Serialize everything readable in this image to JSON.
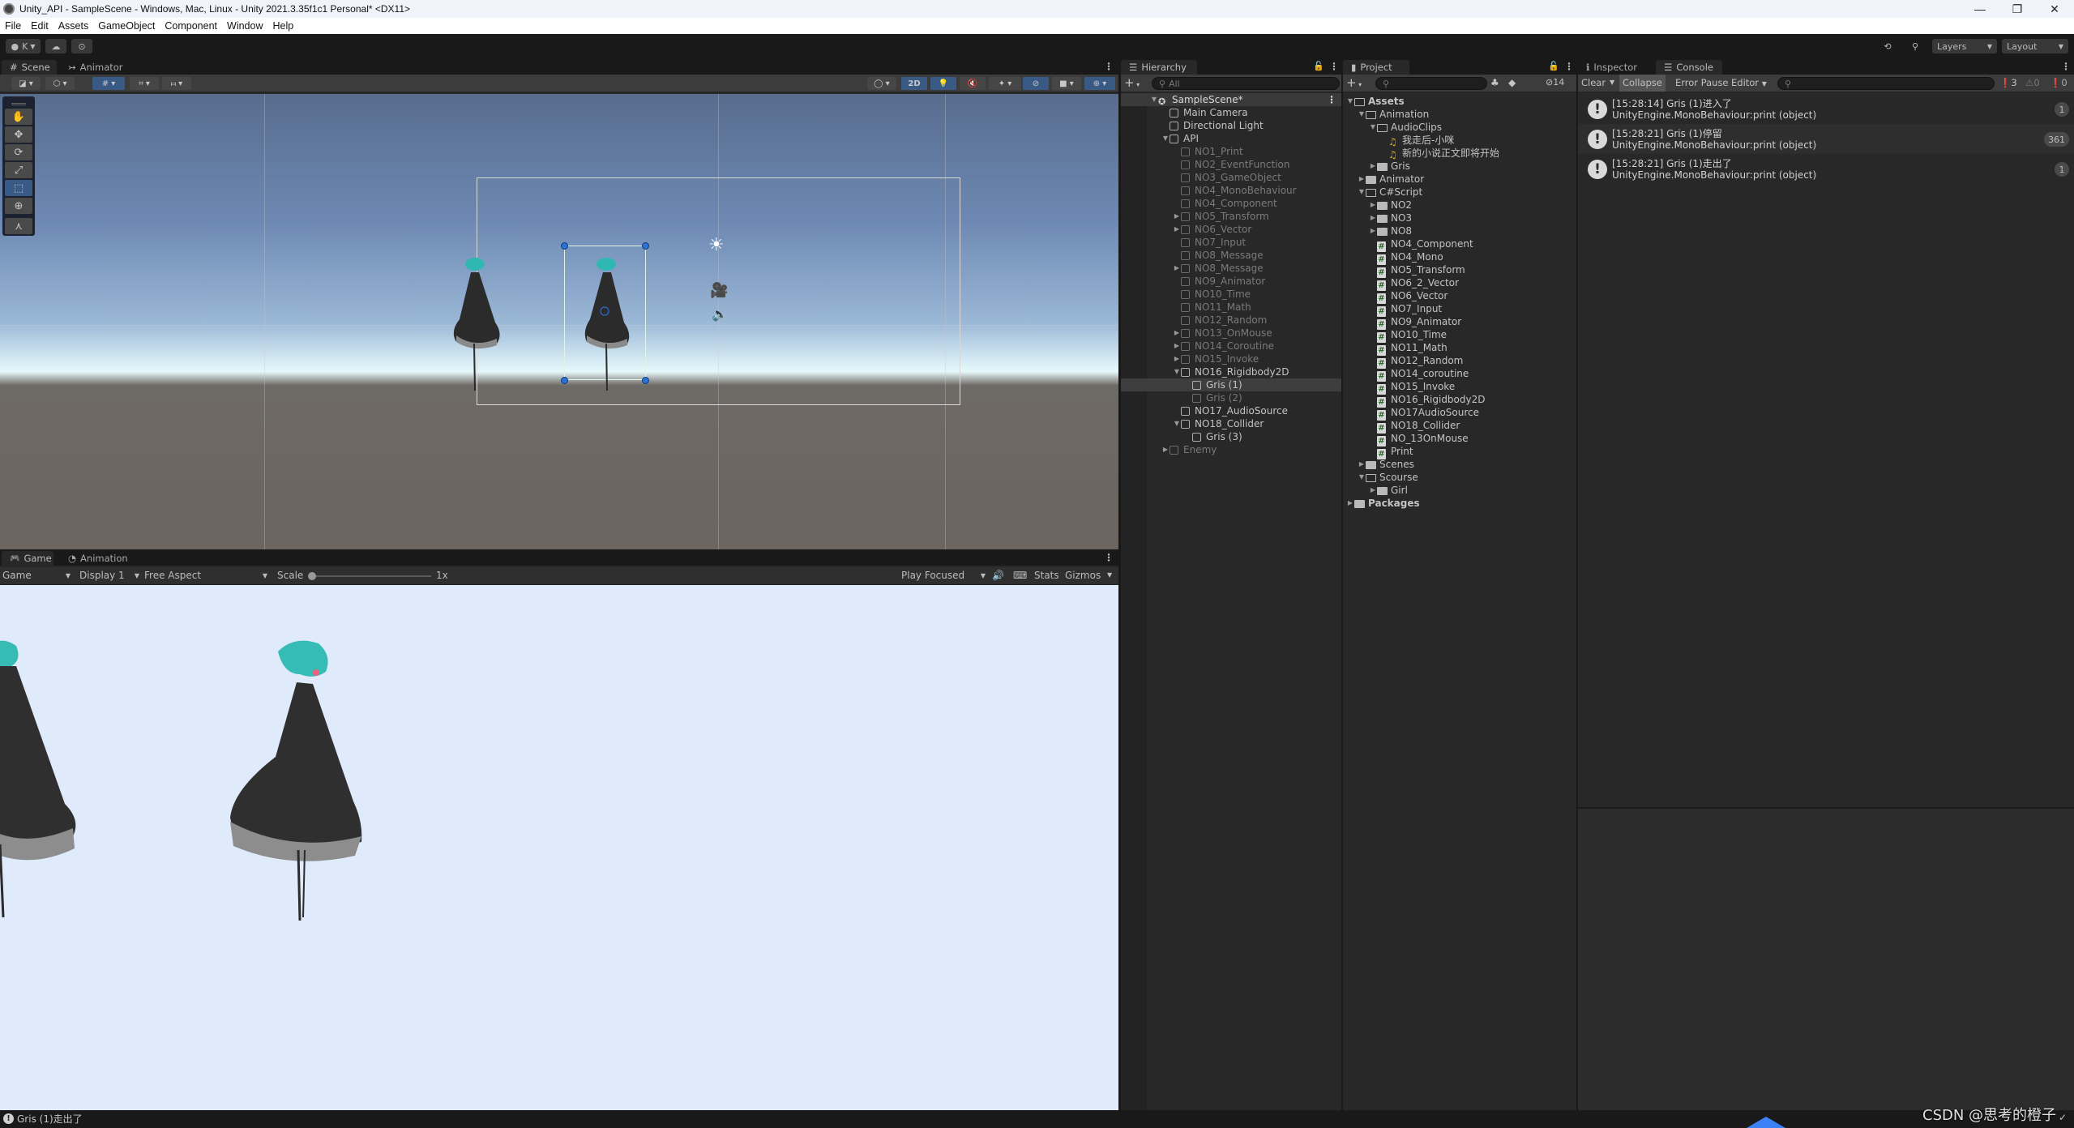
{
  "window": {
    "title": "Unity_API - SampleScene - Windows, Mac, Linux - Unity 2021.3.35f1c1 Personal* <DX11>",
    "controls": {
      "minimize": "—",
      "maximize": "❐",
      "close": "✕"
    }
  },
  "menu": [
    "File",
    "Edit",
    "Assets",
    "GameObject",
    "Component",
    "Window",
    "Help"
  ],
  "main_toolbar": {
    "account_label": "K",
    "play_icon": "▶",
    "pause_icon": "❚❚",
    "step_icon": "▶|",
    "layers_label": "Layers",
    "layout_label": "Layout"
  },
  "scene_panel": {
    "tabs": [
      {
        "label": "Scene",
        "icon": "#"
      },
      {
        "label": "Animator",
        "icon": "↣"
      }
    ],
    "toolbar": {
      "mode_2d": "2D"
    },
    "tools": [
      "hand-tool",
      "move-tool",
      "rotate-tool",
      "scale-tool",
      "rect-tool",
      "transform-tool",
      "custom-tool"
    ]
  },
  "game_panel": {
    "tabs": [
      {
        "label": "Game",
        "icon": "🎮"
      },
      {
        "label": "Animation",
        "icon": "◔"
      }
    ],
    "toolbar": {
      "view_select": "Game",
      "display_select": "Display 1",
      "aspect_select": "Free Aspect",
      "scale_label": "Scale",
      "scale_value": "1x",
      "scale_fraction": 0.0,
      "play_mode_select": "Play Focused",
      "stats_label": "Stats",
      "gizmos_label": "Gizmos"
    }
  },
  "hierarchy": {
    "tab_label": "Hierarchy",
    "search_placeholder": "All",
    "items": [
      {
        "label": "SampleScene*",
        "depth": 0,
        "arrow": "▼",
        "icon": "unity",
        "style": "scene"
      },
      {
        "label": "Main Camera",
        "depth": 1,
        "arrow": "",
        "icon": "cube",
        "style": "normal"
      },
      {
        "label": "Directional Light",
        "depth": 1,
        "arrow": "",
        "icon": "cube",
        "style": "normal"
      },
      {
        "label": "API",
        "depth": 1,
        "arrow": "▼",
        "icon": "cube",
        "style": "normal"
      },
      {
        "label": "NO1_Print",
        "depth": 2,
        "arrow": "",
        "icon": "cube",
        "style": "dim"
      },
      {
        "label": "NO2_EventFunction",
        "depth": 2,
        "arrow": "",
        "icon": "cube",
        "style": "dim"
      },
      {
        "label": "NO3_GameObject",
        "depth": 2,
        "arrow": "",
        "icon": "cube",
        "style": "dim"
      },
      {
        "label": "NO4_MonoBehaviour",
        "depth": 2,
        "arrow": "",
        "icon": "cube",
        "style": "dim"
      },
      {
        "label": "NO4_Component",
        "depth": 2,
        "arrow": "",
        "icon": "cube",
        "style": "dim"
      },
      {
        "label": "NO5_Transform",
        "depth": 2,
        "arrow": "▶",
        "icon": "cube",
        "style": "dim"
      },
      {
        "label": "NO6_Vector",
        "depth": 2,
        "arrow": "▶",
        "icon": "cube",
        "style": "dim"
      },
      {
        "label": "NO7_Input",
        "depth": 2,
        "arrow": "",
        "icon": "cube",
        "style": "dim"
      },
      {
        "label": "NO8_Message",
        "depth": 2,
        "arrow": "",
        "icon": "cube",
        "style": "dim"
      },
      {
        "label": "NO8_Message",
        "depth": 2,
        "arrow": "▶",
        "icon": "cube",
        "style": "dim"
      },
      {
        "label": "NO9_Animator",
        "depth": 2,
        "arrow": "",
        "icon": "cube",
        "style": "dim"
      },
      {
        "label": "NO10_Time",
        "depth": 2,
        "arrow": "",
        "icon": "cube",
        "style": "dim"
      },
      {
        "label": "NO11_Math",
        "depth": 2,
        "arrow": "",
        "icon": "cube",
        "style": "dim"
      },
      {
        "label": "NO12_Random",
        "depth": 2,
        "arrow": "",
        "icon": "cube",
        "style": "dim"
      },
      {
        "label": "NO13_OnMouse",
        "depth": 2,
        "arrow": "▶",
        "icon": "cube",
        "style": "dim"
      },
      {
        "label": "NO14_Coroutine",
        "depth": 2,
        "arrow": "▶",
        "icon": "cube",
        "style": "dim"
      },
      {
        "label": "NO15_Invoke",
        "depth": 2,
        "arrow": "▶",
        "icon": "cube",
        "style": "dim"
      },
      {
        "label": "NO16_Rigidbody2D",
        "depth": 2,
        "arrow": "▼",
        "icon": "cube",
        "style": "normal"
      },
      {
        "label": "Gris (1)",
        "depth": 3,
        "arrow": "",
        "icon": "cube",
        "style": "selected"
      },
      {
        "label": "Gris (2)",
        "depth": 3,
        "arrow": "",
        "icon": "cube",
        "style": "dim"
      },
      {
        "label": "NO17_AudioSource",
        "depth": 2,
        "arrow": "",
        "icon": "cube",
        "style": "normal"
      },
      {
        "label": "NO18_Collider",
        "depth": 2,
        "arrow": "▼",
        "icon": "cube",
        "style": "normal"
      },
      {
        "label": "Gris (3)",
        "depth": 3,
        "arrow": "",
        "icon": "cube",
        "style": "normal"
      },
      {
        "label": "Enemy",
        "depth": 1,
        "arrow": "▶",
        "icon": "cube",
        "style": "dim"
      }
    ]
  },
  "project": {
    "tab_label": "Project",
    "hidden_count": "14",
    "items": [
      {
        "label": "Assets",
        "depth": 0,
        "arrow": "▼",
        "icon": "folder-open",
        "bold": true
      },
      {
        "label": "Animation",
        "depth": 1,
        "arrow": "▼",
        "icon": "folder-open"
      },
      {
        "label": "AudioClips",
        "depth": 2,
        "arrow": "▼",
        "icon": "folder-open"
      },
      {
        "label": "我走后-小咪",
        "depth": 3,
        "arrow": "",
        "icon": "audio"
      },
      {
        "label": "新的小说正文即将开始",
        "depth": 3,
        "arrow": "",
        "icon": "audio"
      },
      {
        "label": "Gris",
        "depth": 2,
        "arrow": "▶",
        "icon": "folder"
      },
      {
        "label": "Animator",
        "depth": 1,
        "arrow": "▶",
        "icon": "folder"
      },
      {
        "label": "C#Script",
        "depth": 1,
        "arrow": "▼",
        "icon": "folder-open"
      },
      {
        "label": "NO2",
        "depth": 2,
        "arrow": "▶",
        "icon": "folder"
      },
      {
        "label": "NO3",
        "depth": 2,
        "arrow": "▶",
        "icon": "folder"
      },
      {
        "label": "NO8",
        "depth": 2,
        "arrow": "▶",
        "icon": "folder"
      },
      {
        "label": "NO4_Component",
        "depth": 2,
        "arrow": "",
        "icon": "script"
      },
      {
        "label": "NO4_Mono",
        "depth": 2,
        "arrow": "",
        "icon": "script"
      },
      {
        "label": "NO5_Transform",
        "depth": 2,
        "arrow": "",
        "icon": "script"
      },
      {
        "label": "NO6_2_Vector",
        "depth": 2,
        "arrow": "",
        "icon": "script"
      },
      {
        "label": "NO6_Vector",
        "depth": 2,
        "arrow": "",
        "icon": "script"
      },
      {
        "label": "NO7_Input",
        "depth": 2,
        "arrow": "",
        "icon": "script"
      },
      {
        "label": "NO9_Animator",
        "depth": 2,
        "arrow": "",
        "icon": "script"
      },
      {
        "label": "NO10_Time",
        "depth": 2,
        "arrow": "",
        "icon": "script"
      },
      {
        "label": "NO11_Math",
        "depth": 2,
        "arrow": "",
        "icon": "script"
      },
      {
        "label": "NO12_Random",
        "depth": 2,
        "arrow": "",
        "icon": "script"
      },
      {
        "label": "NO14_coroutine",
        "depth": 2,
        "arrow": "",
        "icon": "script"
      },
      {
        "label": "NO15_Invoke",
        "depth": 2,
        "arrow": "",
        "icon": "script"
      },
      {
        "label": "NO16_Rigidbody2D",
        "depth": 2,
        "arrow": "",
        "icon": "script"
      },
      {
        "label": "NO17AudioSource",
        "depth": 2,
        "arrow": "",
        "icon": "script"
      },
      {
        "label": "NO18_Collider",
        "depth": 2,
        "arrow": "",
        "icon": "script"
      },
      {
        "label": "NO_13OnMouse",
        "depth": 2,
        "arrow": "",
        "icon": "script"
      },
      {
        "label": "Print",
        "depth": 2,
        "arrow": "",
        "icon": "script"
      },
      {
        "label": "Scenes",
        "depth": 1,
        "arrow": "▶",
        "icon": "folder"
      },
      {
        "label": "Scourse",
        "depth": 1,
        "arrow": "▼",
        "icon": "folder-open"
      },
      {
        "label": "Girl",
        "depth": 2,
        "arrow": "▶",
        "icon": "folder"
      },
      {
        "label": "Packages",
        "depth": 0,
        "arrow": "▶",
        "icon": "folder",
        "bold": true
      }
    ]
  },
  "console": {
    "tabs": [
      {
        "label": "Inspector",
        "icon": "ℹ"
      },
      {
        "label": "Console",
        "icon": "☰"
      }
    ],
    "toolbar": {
      "clear": "Clear",
      "collapse": "Collapse",
      "error_pause": "Error Pause",
      "editor": "Editor",
      "info_count": "3",
      "warning_count": "0",
      "error_count": "0"
    },
    "logs": [
      {
        "line1": "[15:28:14] Gris (1)进入了",
        "line2": "UnityEngine.MonoBehaviour:print (object)",
        "count": "1"
      },
      {
        "line1": "[15:28:21] Gris (1)停留",
        "line2": "UnityEngine.MonoBehaviour:print (object)",
        "count": "361"
      },
      {
        "line1": "[15:28:21] Gris (1)走出了",
        "line2": "UnityEngine.MonoBehaviour:print (object)",
        "count": "1"
      }
    ]
  },
  "status_bar": {
    "message": "Gris (1)走出了",
    "watermark": "CSDN @思考的橙子"
  },
  "colors": {
    "accent_blue": "#3a5a86",
    "panel_bg": "#282828",
    "game_bg": "#dfeafb",
    "audio_icon": "#e5b21b",
    "script_hash": "#2c6b2c"
  }
}
